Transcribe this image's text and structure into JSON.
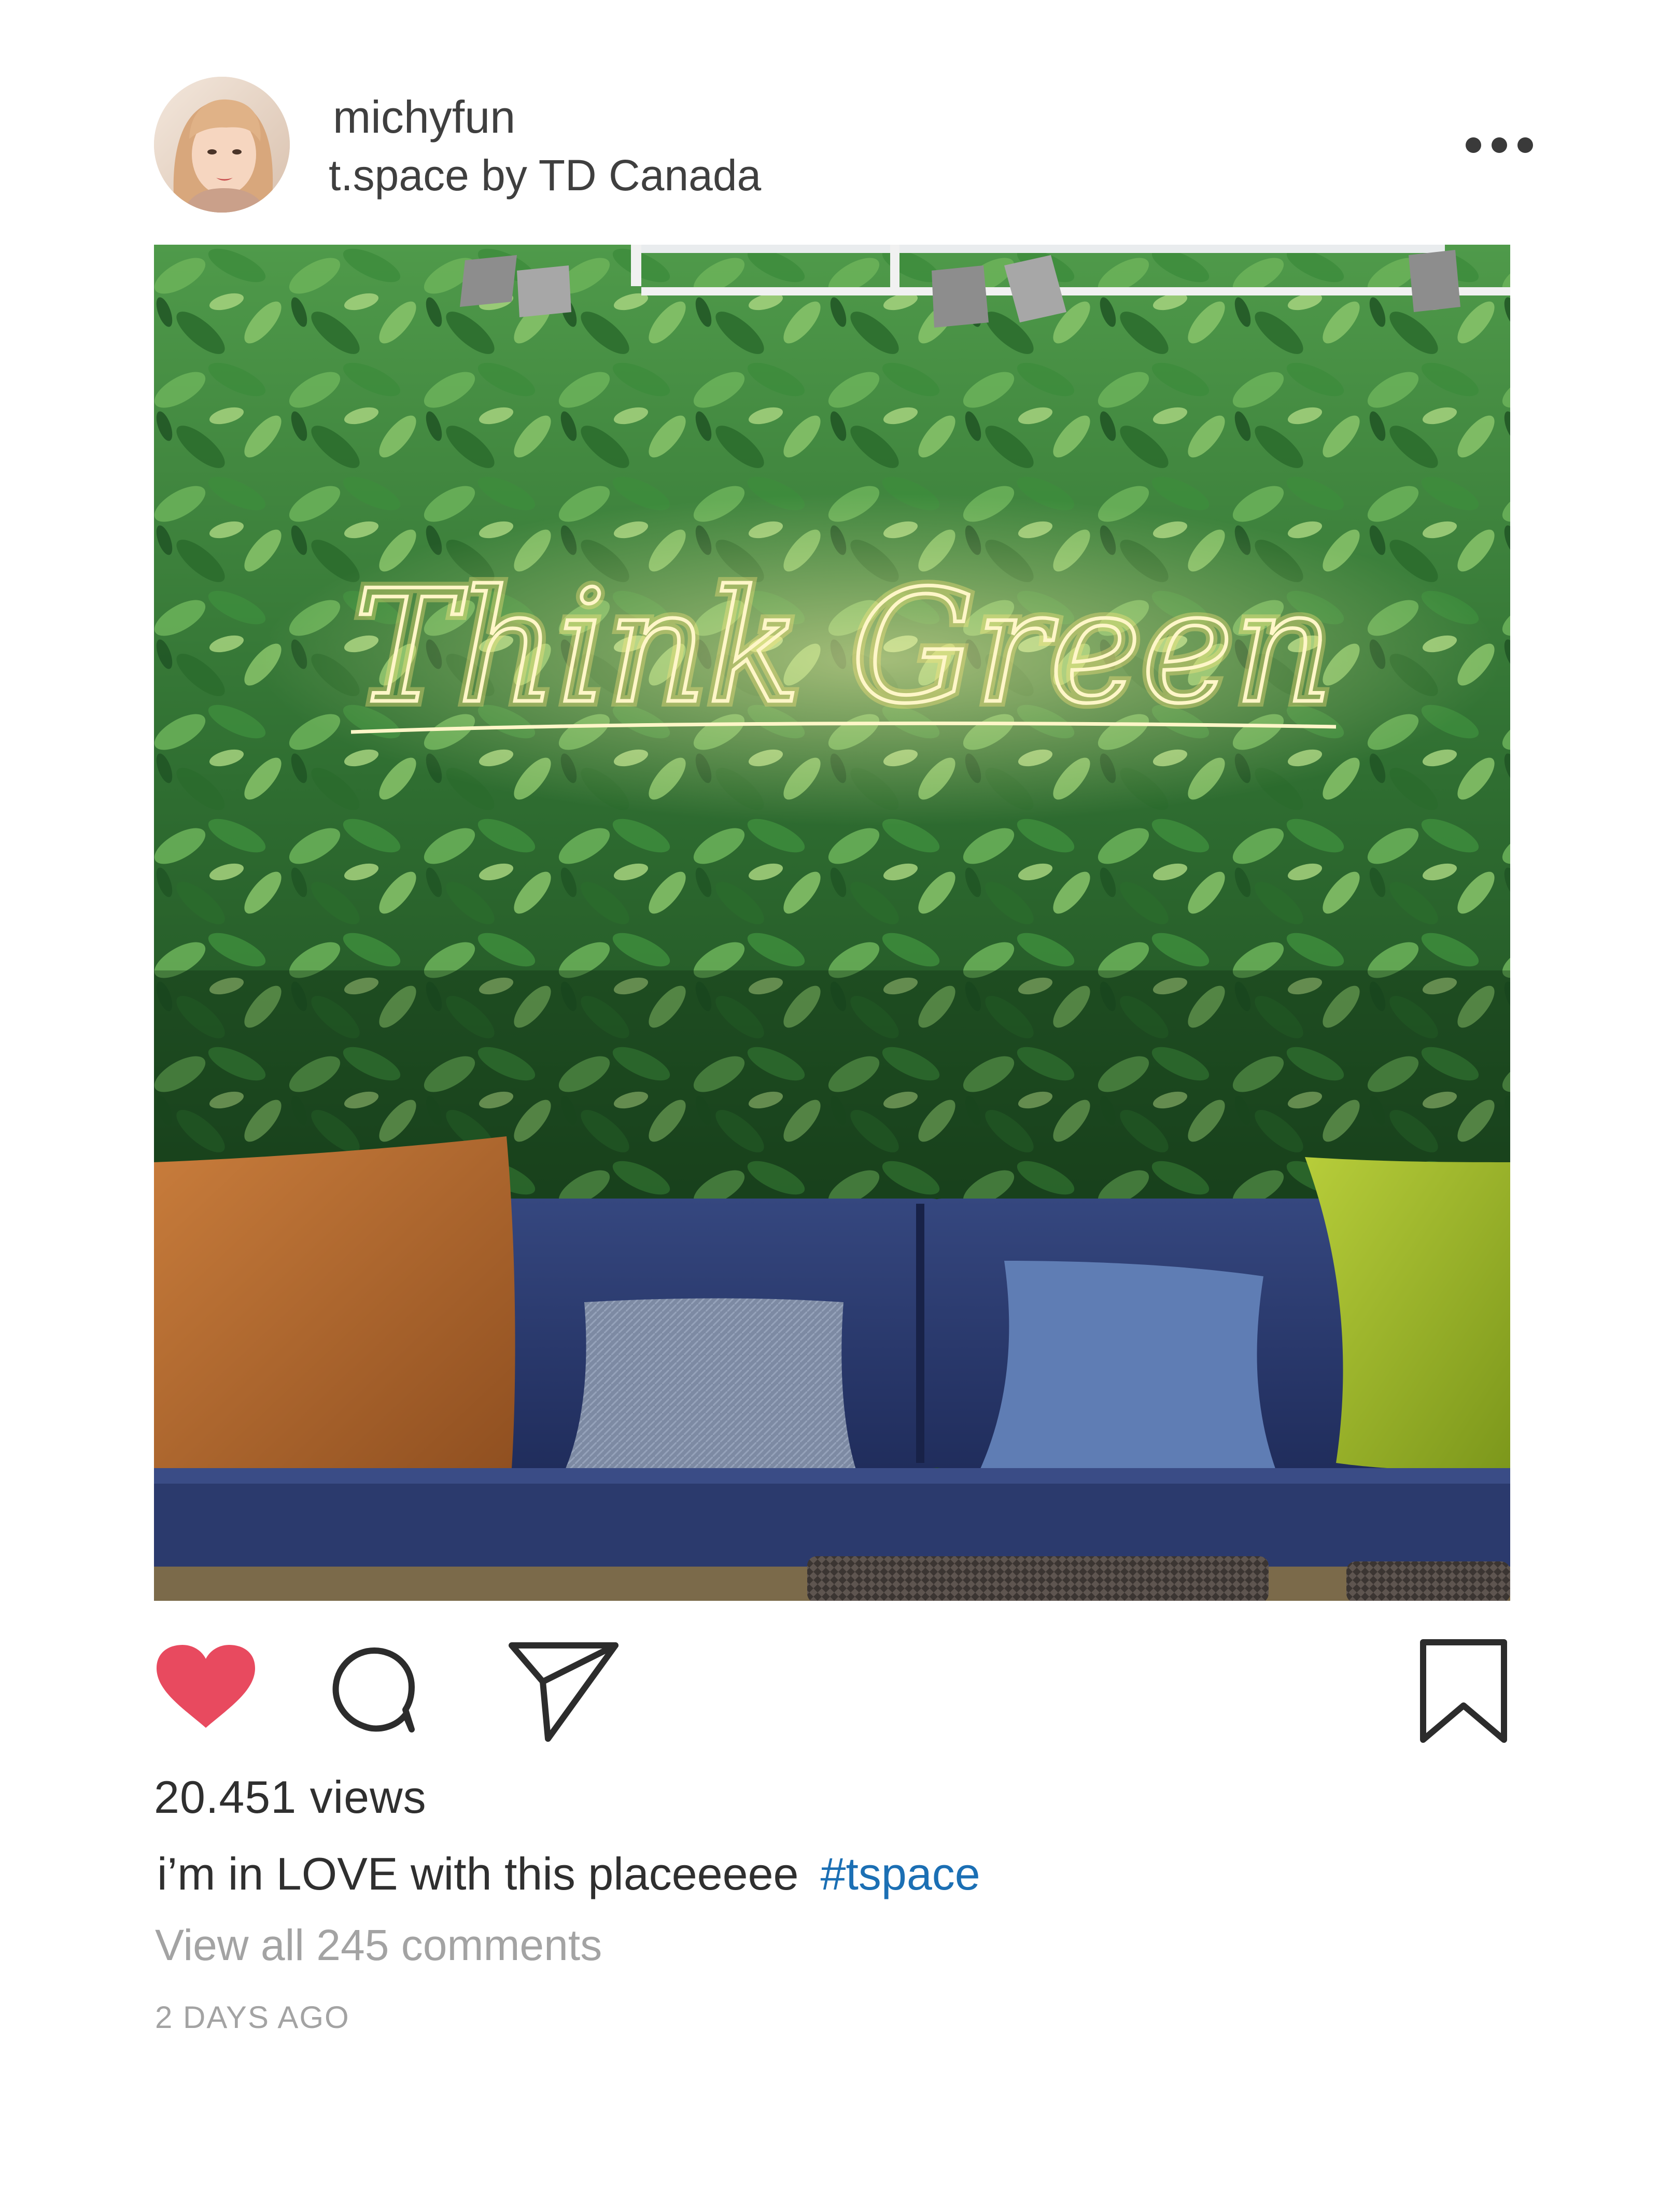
{
  "post": {
    "username": "michyfun",
    "location": "t.space by TD Canada",
    "photo": {
      "neon_sign_text": "Think Green"
    },
    "views": "20.451 views",
    "caption": {
      "text": "i’m in LOVE with this placeeeee",
      "hashtag": "#tspace"
    },
    "comments_link": "View all 245 comments",
    "timestamp": "2 DAYS AGO"
  },
  "icons": {
    "more": "more-horizontal-icon",
    "like": "heart-icon",
    "comment": "comment-bubble-icon",
    "share": "paper-plane-icon",
    "save": "bookmark-icon"
  },
  "colors": {
    "like_active": "#e84a5f",
    "hashtag": "#1b6fb4",
    "muted_text": "#a3a3a3",
    "neon": "#fff4a8"
  }
}
